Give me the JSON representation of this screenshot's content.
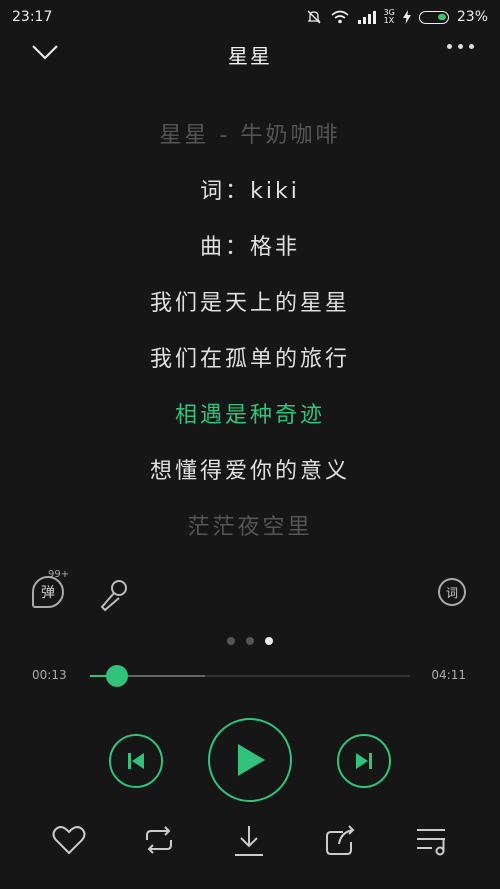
{
  "status": {
    "time": "23:17",
    "network_top": "3G",
    "network_bottom": "1X",
    "battery": "23%",
    "battery_color": "#3cc46c"
  },
  "header": {
    "title": "星星",
    "back_icon": "chevron-down-icon",
    "more_icon": "more-dots-icon"
  },
  "lyrics": [
    {
      "text": "星星 - 牛奶咖啡",
      "state": "faded"
    },
    {
      "text": "词：kiki",
      "state": "normal"
    },
    {
      "text": "曲：格非",
      "state": "normal"
    },
    {
      "text": "我们是天上的星星",
      "state": "normal"
    },
    {
      "text": "我们在孤单的旅行",
      "state": "normal"
    },
    {
      "text": "相遇是种奇迹",
      "state": "active"
    },
    {
      "text": "想懂得爱你的意义",
      "state": "normal"
    },
    {
      "text": "茫茫夜空里",
      "state": "faded"
    }
  ],
  "tools": {
    "danmu_label": "弹",
    "danmu_count": "99+",
    "lyric_toggle_label": "词"
  },
  "pager": {
    "count": 3,
    "active": 2
  },
  "playback": {
    "current_time": "00:13",
    "total_time": "04:11",
    "progress": 0.085,
    "buffered": 0.36
  },
  "colors": {
    "accent": "#31c27c",
    "background": "#161616"
  }
}
